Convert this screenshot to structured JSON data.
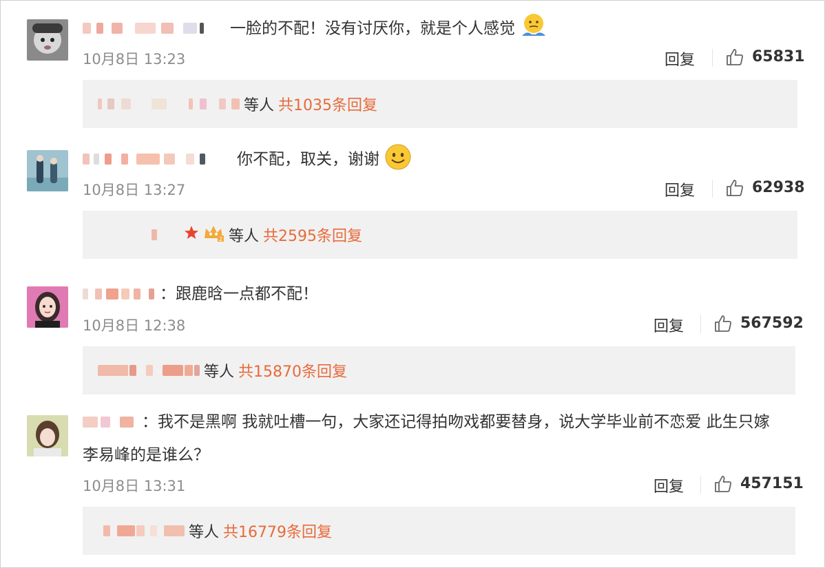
{
  "comments": [
    {
      "text": "一脸的不配！没有讨厌你，就是个人感觉",
      "emoji": "shrug-face-emoji",
      "time": "10月8日 13:23",
      "reply_label": "回复",
      "likes": "65831",
      "sub_suffix": "等人",
      "sub_count": "共1035条回复"
    },
    {
      "text": "你不配，取关，谢谢",
      "emoji": "smile-face-emoji",
      "time": "10月8日 13:27",
      "reply_label": "回复",
      "likes": "62938",
      "sub_suffix": "等人",
      "sub_count": "共2595条回复"
    },
    {
      "text": "：跟鹿晗一点都不配！",
      "time": "10月8日 12:38",
      "reply_label": "回复",
      "likes": "567592",
      "sub_suffix": "等人",
      "sub_count": "共15870条回复"
    },
    {
      "text_line1": "：我不是黑啊 我就吐槽一句，大家还记得拍吻戏都要替身，说大学毕业前不恋爱 此生只嫁",
      "text_line2": "李易峰的是谁么？",
      "time": "10月8日 13:31",
      "reply_label": "回复",
      "likes": "457151",
      "sub_suffix": "等人",
      "sub_count": "共16779条回复"
    }
  ],
  "colors": {
    "accent": "#e86a3a",
    "time": "#8c8c8c",
    "subbox": "#f1f1f1"
  }
}
